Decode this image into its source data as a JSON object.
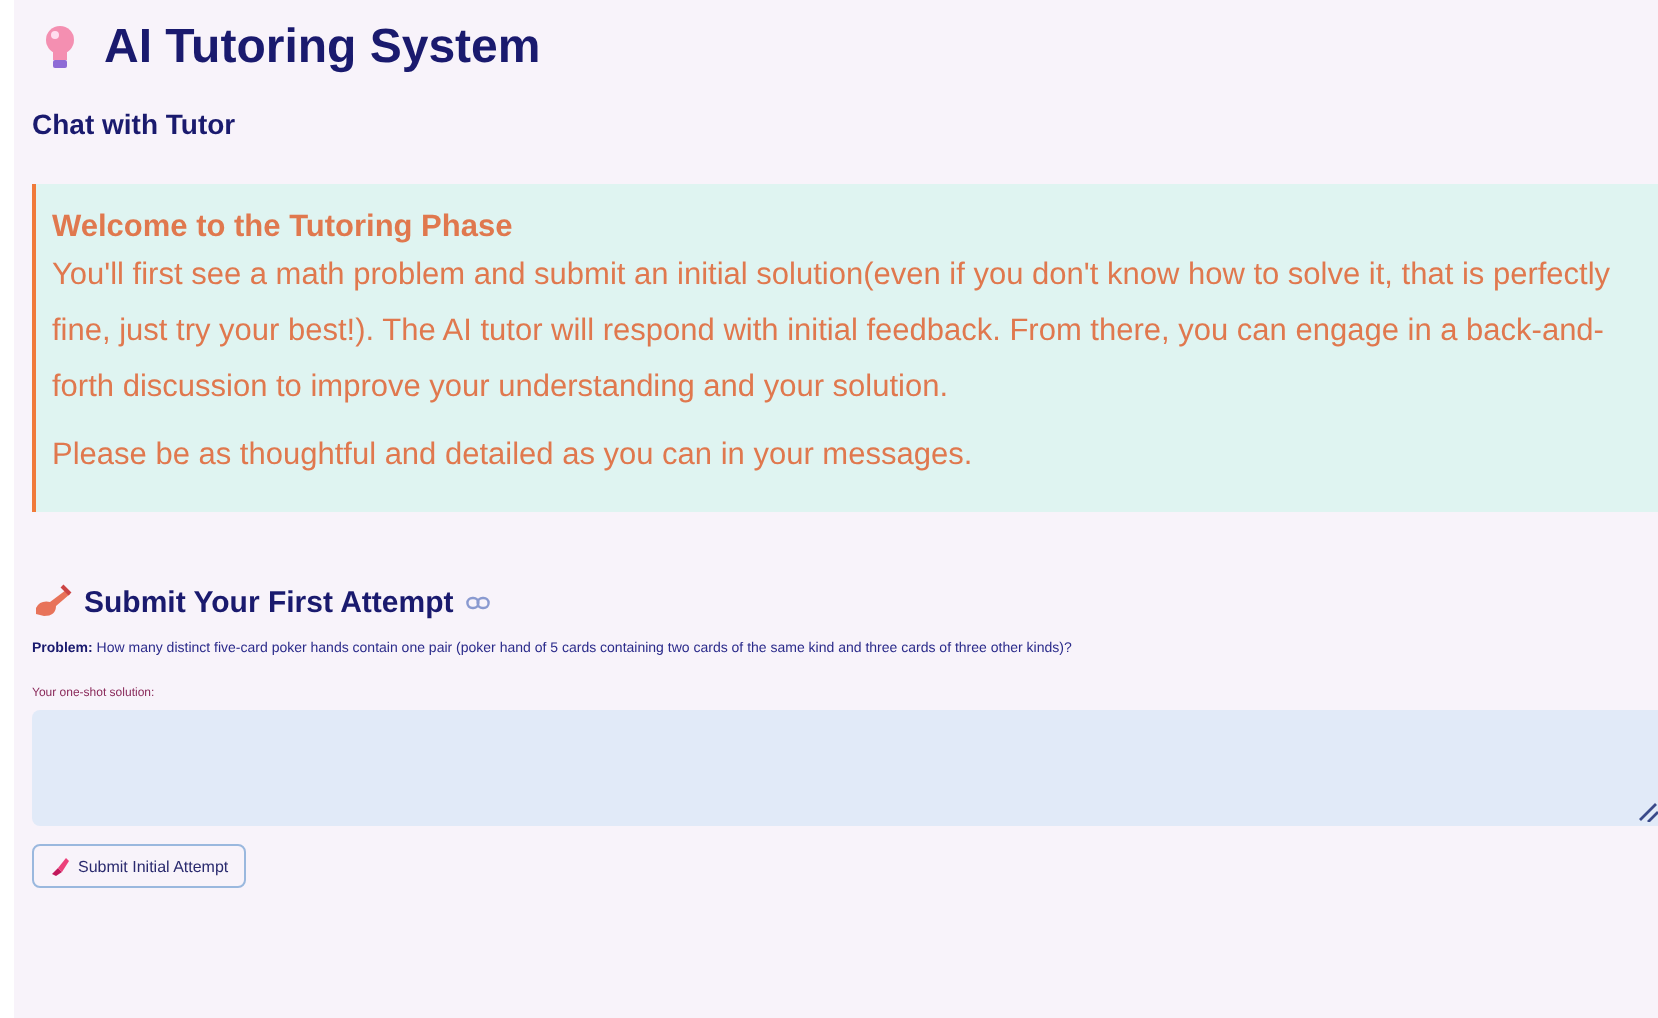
{
  "title": "AI Tutoring System",
  "subtitle": "Chat with Tutor",
  "info": {
    "heading": "Welcome to the Tutoring Phase",
    "paragraphs": [
      "You'll first see a math problem and submit an initial solution(even if you don't know how to solve it, that is perfectly fine, just try your best!). The AI tutor will respond with initial feedback. From there, you can engage in a back-and-forth discussion to improve your understanding and your solution.",
      "Please be as thoughtful and detailed as you can in your messages."
    ]
  },
  "section": {
    "heading": "Submit Your First Attempt",
    "problem": "**Problem:** How many distinct five-card poker hands contain one pair (poker hand of 5 cards containing two cards of the same kind and three cards of three other kinds)?",
    "field_label": "Your one-shot solution:",
    "button": "Submit Initial Attempt"
  }
}
